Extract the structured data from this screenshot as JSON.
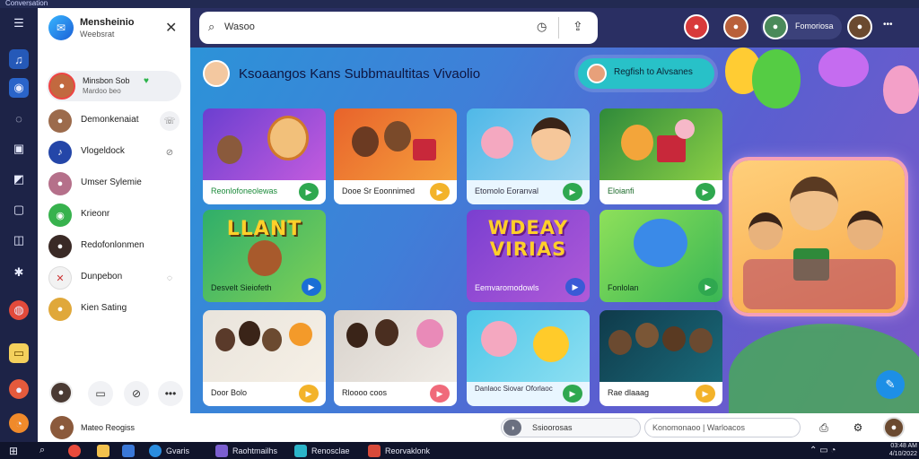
{
  "window": {
    "title": "Conversation"
  },
  "rail": {
    "icons": [
      "menu-icon",
      "app-icon-1",
      "app-icon-2",
      "circle-icon",
      "chat-icon",
      "terminal-icon",
      "box-icon",
      "folder-icon",
      "gear-icon",
      "world-icon",
      "note-icon",
      "rocket-icon",
      "alert-icon"
    ]
  },
  "sidebar": {
    "title": "Mensheinio",
    "subtitle": "Weebsrat",
    "active": {
      "name": "Minsbon Sob",
      "sub": "Mardoo beo"
    },
    "contacts": [
      {
        "name": "Demonkenaiat"
      },
      {
        "name": "Vlogeldock"
      },
      {
        "name": "Umser Sylemie"
      },
      {
        "name": "Krieonr"
      },
      {
        "name": "Redofonlonmen"
      },
      {
        "name": "Dunpebon"
      },
      {
        "name": "Kien Sating"
      }
    ],
    "footer_user": "Mateo Reogiss"
  },
  "search": {
    "placeholder": "Wasoo"
  },
  "topbar": {
    "user_name": "Fomoriosa"
  },
  "hero": {
    "title": "Ksoaangos Kans Subbmaultitas Vivaolio",
    "register_label": "Regfish to Alvsanes"
  },
  "tiles": [
    {
      "label": "Reonlofoneolewas",
      "art": "classroom-cartoon"
    },
    {
      "label": "Dooe Sr Eoonnimed",
      "art": "family-gift-cartoon"
    },
    {
      "label": "Etomolo Eoranval",
      "art": "pig-and-girl-cartoon"
    },
    {
      "label": "Eloianfi",
      "art": "playful-gift-cartoon"
    },
    {
      "label": "Desvelt Sieiofeth",
      "art": "laugh-cartoon",
      "headline": "LLANT"
    },
    {
      "label": "Eemvaromodowls",
      "art": "wdeay-virias",
      "headline": "WDEAY VIRIAS"
    },
    {
      "label": "Fonlolan",
      "art": "blue-creature-cartoon"
    },
    {
      "label": "Door Bolo",
      "art": "family-photo"
    },
    {
      "label": "Rloooo coos",
      "art": "family-with-grandmother"
    },
    {
      "label": "Danlaoc Siovar Oforlaoc",
      "art": "pig-emoji-cartoon"
    },
    {
      "label": "Rae dlaaag",
      "art": "friends-photo"
    }
  ],
  "bottombar": {
    "compose_placeholder": "Ssioorosas",
    "translate_placeholder": "Konomonaoo | Warloacos"
  },
  "taskbar": {
    "items": [
      "Gvaris",
      "Raohtmailhs",
      "Renosclae",
      "Reorvaklonk"
    ],
    "time": "03:48 AM",
    "date": "4/10/2022"
  }
}
